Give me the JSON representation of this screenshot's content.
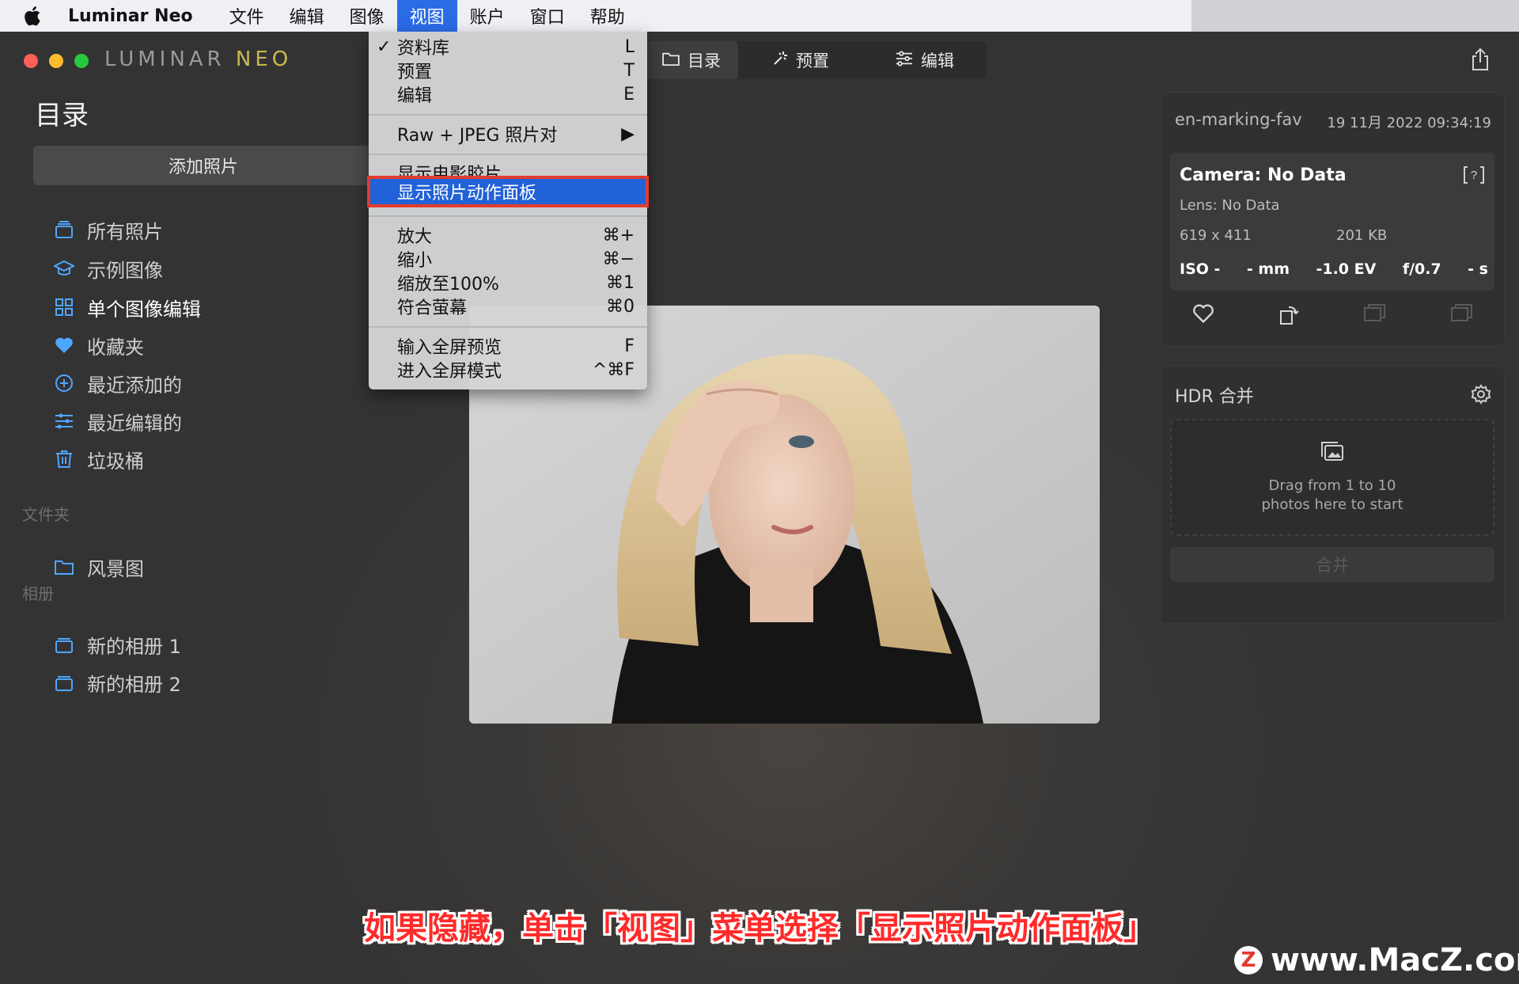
{
  "menubar": {
    "app_name": "Luminar Neo",
    "items": [
      "文件",
      "编辑",
      "图像",
      "视图",
      "账户",
      "窗口",
      "帮助"
    ],
    "active_item": "视图"
  },
  "window": {
    "logo_main": "LUMINAR ",
    "logo_accent": "NEO",
    "title": "目录",
    "add_photos": "添加照片"
  },
  "sidebar": {
    "items": [
      {
        "label": "所有照片",
        "icon": "stack-icon"
      },
      {
        "label": "示例图像",
        "icon": "graduation-cap-icon"
      },
      {
        "label": "单个图像编辑",
        "icon": "grid-icon",
        "selected": true
      },
      {
        "label": "收藏夹",
        "icon": "heart-icon"
      },
      {
        "label": "最近添加的",
        "icon": "plus-circle-icon"
      },
      {
        "label": "最近编辑的",
        "icon": "sliders-icon"
      },
      {
        "label": "垃圾桶",
        "icon": "trash-icon"
      }
    ],
    "folders_label": "文件夹",
    "folders": [
      {
        "label": "风景图",
        "icon": "folder-icon"
      }
    ],
    "albums_label": "相册",
    "albums": [
      {
        "label": "新的相册 1",
        "icon": "album-icon"
      },
      {
        "label": "新的相册 2",
        "icon": "album-icon"
      }
    ]
  },
  "tabs": [
    {
      "label": "目录",
      "icon": "folder-icon",
      "active": true
    },
    {
      "label": "预置",
      "icon": "sparkle-icon"
    },
    {
      "label": "编辑",
      "icon": "sliders-icon"
    }
  ],
  "view_menu": {
    "items": [
      {
        "label": "资料库",
        "shortcut": "L",
        "checked": true
      },
      {
        "label": "预置",
        "shortcut": "T"
      },
      {
        "label": "编辑",
        "shortcut": "E"
      },
      {
        "label": "Raw + JPEG 照片对",
        "shortcut": "▶"
      },
      {
        "label": "显示电影胶片",
        "shortcut": ""
      },
      {
        "label": "显示照片动作面板",
        "shortcut": "",
        "highlighted": true
      },
      {
        "label": "放大",
        "shortcut": "⌘+"
      },
      {
        "label": "缩小",
        "shortcut": "⌘−"
      },
      {
        "label": "缩放至100%",
        "shortcut": "⌘1"
      },
      {
        "label": "符合萤幕",
        "shortcut": "⌘0"
      },
      {
        "label": "输入全屏预览",
        "shortcut": "F"
      },
      {
        "label": "进入全屏模式",
        "shortcut": "^⌘F"
      }
    ]
  },
  "info_panel": {
    "filename": "en-marking-fav",
    "date": "19 11月 2022 09:34:19",
    "camera": "Camera: No Data",
    "lens": "Lens: No Data",
    "dimensions": "619 x 411",
    "file_size": "201 KB",
    "exif": [
      "ISO -",
      "- mm",
      "-1.0 EV",
      "f/0.7",
      "- s"
    ]
  },
  "hdr_panel": {
    "title": "HDR 合并",
    "drop_line1": "Drag from 1 to 10",
    "drop_line2": "photos here to start",
    "merge_button": "合并"
  },
  "caption": "如果隐藏，单击「视图」菜单选择「显示照片动作面板」",
  "watermark": {
    "logo": "Z",
    "text": "www.MacZ.com"
  },
  "colors": {
    "accent_blue": "#4fa6ff",
    "menu_highlight": "#2262d8",
    "highlight_border": "#e33b2e",
    "caption_red": "#ff2a2a"
  }
}
